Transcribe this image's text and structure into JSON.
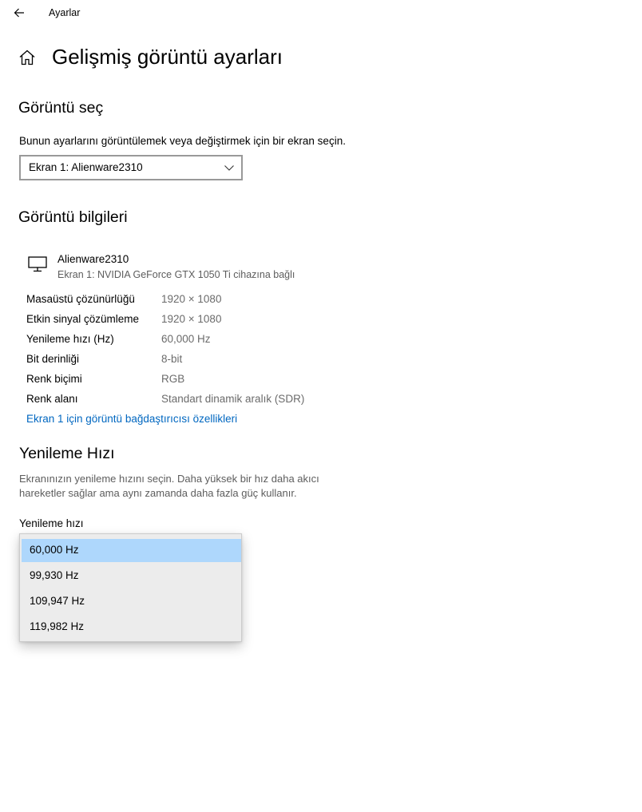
{
  "window": {
    "title": "Ayarlar"
  },
  "page": {
    "title": "Gelişmiş görüntü ayarları"
  },
  "select_display": {
    "heading": "Görüntü seç",
    "description": "Bunun ayarlarını görüntülemek veya değiştirmek için bir ekran seçin.",
    "selected": "Ekran 1: Alienware2310"
  },
  "display_info": {
    "heading": "Görüntü bilgileri",
    "monitor_name": "Alienware2310",
    "monitor_subtitle": "Ekran 1: NVIDIA GeForce GTX 1050 Ti cihazına bağlı",
    "rows": [
      {
        "label": "Masaüstü çözünürlüğü",
        "value": "1920 × 1080"
      },
      {
        "label": "Etkin sinyal çözümleme",
        "value": "1920 × 1080"
      },
      {
        "label": "Yenileme hızı (Hz)",
        "value": "60,000 Hz"
      },
      {
        "label": "Bit derinliği",
        "value": "8-bit"
      },
      {
        "label": "Renk biçimi",
        "value": "RGB"
      },
      {
        "label": "Renk alanı",
        "value": "Standart dinamik aralık (SDR)"
      }
    ],
    "adapter_link": "Ekran 1 için görüntü bağdaştırıcısı özellikleri"
  },
  "refresh_rate": {
    "heading": "Yenileme Hızı",
    "description_line1": "Ekranınızın yenileme hızını seçin. Daha yüksek bir hız daha akıcı",
    "description_line2": "hareketler sağlar ama aynı zamanda daha fazla güç kullanır.",
    "field_label": "Yenileme hızı",
    "options": [
      {
        "label": "60,000 Hz",
        "selected": true
      },
      {
        "label": "99,930 Hz",
        "selected": false
      },
      {
        "label": "109,947 Hz",
        "selected": false
      },
      {
        "label": "119,982 Hz",
        "selected": false
      }
    ]
  },
  "icons": {
    "back": "back-arrow-icon",
    "home": "home-icon",
    "chevron": "chevron-down-icon",
    "monitor": "monitor-icon"
  },
  "colors": {
    "link": "#0067c0",
    "selection": "#aed7fc",
    "secondary_text": "#5d5d5d"
  }
}
